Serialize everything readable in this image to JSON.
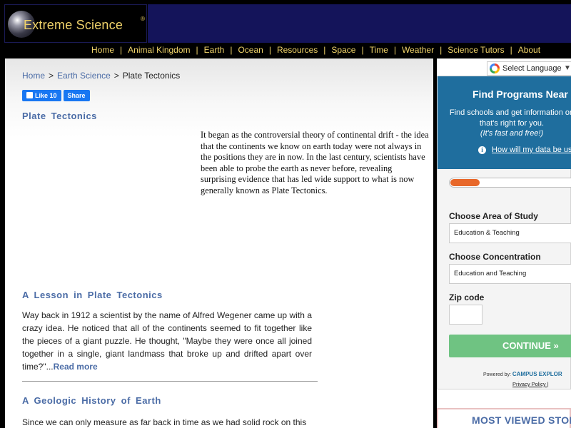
{
  "header": {
    "logo_text": "Extreme Science",
    "logo_reg": "®"
  },
  "nav": {
    "items": [
      "Home",
      "Animal Kingdom",
      "Earth",
      "Ocean",
      "Resources",
      "Space",
      "Time",
      "Weather",
      "Science Tutors",
      "About"
    ],
    "separator": "|"
  },
  "breadcrumb": {
    "items": [
      "Home",
      "Earth Science",
      "Plate Tectonics"
    ],
    "separator": ">"
  },
  "social": {
    "like_label": "Like",
    "like_count": "10",
    "share_label": "Share"
  },
  "article": {
    "title": "Plate Tectonics",
    "intro": "It began as the controversial theory of continental drift - the idea that the continents we know on earth today were not always in the positions they are in now. In the last century, scientists have been able to probe the earth as never before, revealing surprising evidence that has led wide support to what is now generally known as Plate Tectonics.",
    "lesson_title": "A Lesson in Plate Tectonics",
    "lesson_text": "Way back in 1912 a scientist by the name of Alfred Wegener came up with a crazy idea. He noticed that all of the continents seemed to fit together like the pieces of a giant puzzle. He thought, \"Maybe they were once all joined together in a single, giant landmass that broke up and drifted apart over time?\"...",
    "read_more": "Read more",
    "geo_title": "A Geologic History of Earth",
    "geo_text": "Since we can only measure as far back in time as we had solid rock on this"
  },
  "sidebar": {
    "language": "Select Language",
    "promo": {
      "title": "Find Programs Near",
      "desc_line1": "Find schools and get information on",
      "desc_line2": "that's right for you.",
      "note": "(It's fast and free!)",
      "data_link": "How will my data be us",
      "progress": 0.22,
      "area_label": "Choose Area of Study",
      "area_value": "Education & Teaching",
      "concentration_label": "Choose Concentration",
      "concentration_value": "Education and Teaching",
      "zip_label": "Zip code",
      "zip_value": "",
      "continue_label": "CONTINUE",
      "continue_arrows": "»",
      "powered_by": "Powered by:",
      "powered_brand": "CAMPUS EXPLOR",
      "privacy": "Privacy Policy |"
    },
    "most_viewed": "MOST VIEWED STOR"
  },
  "colors": {
    "logo_gold": "#f0d36a",
    "header_band": "#14145a",
    "link_blue": "#4b6ca6",
    "promo_blue": "#1f6e9e",
    "progress_orange": "#e8682a",
    "continue_green": "#6fc382",
    "facebook_blue": "#1877f2"
  }
}
